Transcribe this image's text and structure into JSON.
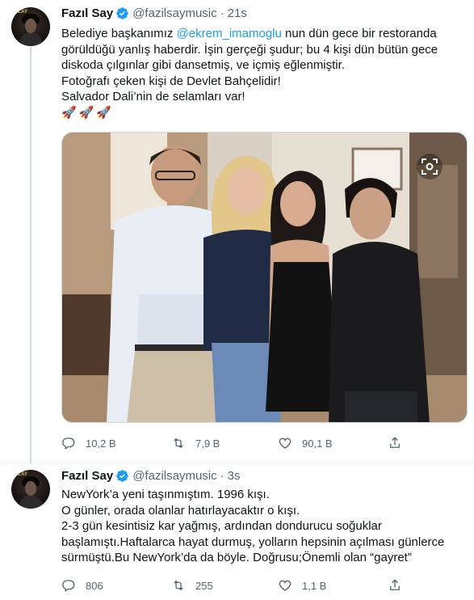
{
  "tweets": [
    {
      "author_name": "Fazıl Say",
      "handle": "@fazilsaymusic",
      "separator": "·",
      "time": "21s",
      "avatar_label": "PLAY",
      "text_lines": {
        "l1_pre": "Belediye başkanımız ",
        "l1_mention": "@ekrem_imamoglu",
        "l1_post": " nun dün gece bir restoranda",
        "l2": "görüldüğü yanlış haberdir. İşin gerçeği şudur; bu 4 kişi dün bütün gece",
        "l3": "diskoda çılgınlar gibi dansetmiş, ve içmiş eğlenmiştir.",
        "l4": "Fotoğrafı çeken kişi de Devlet Bahçelidir!",
        "l5": "Salvador Dali’nin de selamları var!",
        "l6": "🚀🚀🚀"
      },
      "actions": {
        "replies": "10,2 B",
        "retweets": "7,9 B",
        "likes": "90,1 B"
      }
    },
    {
      "author_name": "Fazıl Say",
      "handle": "@fazilsaymusic",
      "separator": "·",
      "time": "3s",
      "avatar_label": "PLAY",
      "text_lines": {
        "l1": "NewYork’a yeni taşınmıştım. 1996 kışı.",
        "l2": "O günler, orada olanlar hatırlayacaktır o kışı.",
        "l3": "2-3 gün kesintisiz kar yağmış, ardından dondurucu soğuklar",
        "l4": "başlamıştı.Haftalarca hayat durmuş, yolların hepsinin açılması günlerce",
        "l5": "sürmüştü.Bu NewYork’da da böyle. Doğrusu;Önemli olan “gayret”"
      },
      "actions": {
        "replies": "806",
        "retweets": "255",
        "likes": "1,1 B"
      }
    }
  ],
  "colors": {
    "accent": "#1d9bf0",
    "secondary_text": "#536471",
    "primary_text": "#0f1419",
    "thread_line": "#cfd9de"
  },
  "icons": [
    "verified-badge-icon",
    "reply-icon",
    "retweet-icon",
    "like-icon",
    "share-icon",
    "lens-icon"
  ]
}
